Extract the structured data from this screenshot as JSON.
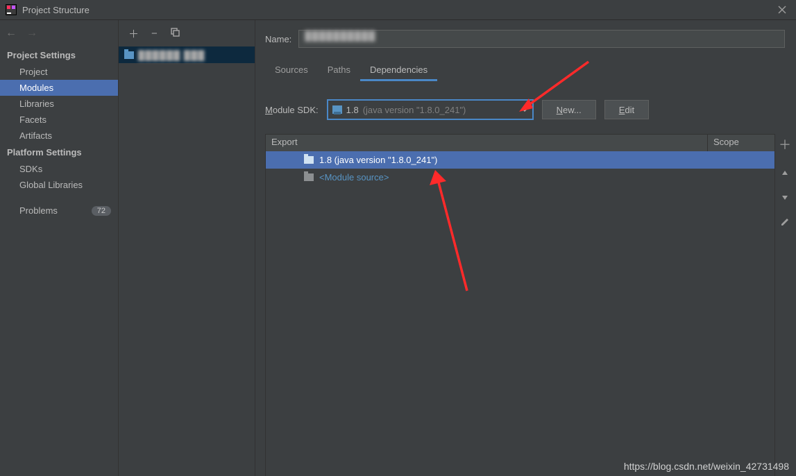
{
  "window": {
    "title": "Project Structure"
  },
  "sidebar": {
    "project_settings_header": "Project Settings",
    "platform_settings_header": "Platform Settings",
    "items": {
      "project": "Project",
      "modules": "Modules",
      "libraries": "Libraries",
      "facets": "Facets",
      "artifacts": "Artifacts",
      "sdks": "SDKs",
      "global_libraries": "Global Libraries",
      "problems": "Problems"
    },
    "problems_count": "72"
  },
  "modules_list": {
    "selected_module_name": "██████ ███"
  },
  "main": {
    "name_label": "Name:",
    "name_value": "██████████",
    "tabs": {
      "sources": "Sources",
      "paths": "Paths",
      "dependencies": "Dependencies"
    },
    "sdk_label_prefix": "M",
    "sdk_label_rest": "odule SDK:",
    "sdk_value_primary": "1.8 ",
    "sdk_value_gray": "(java version \"1.8.0_241\")",
    "new_btn": "New...",
    "edit_btn": "Edit",
    "table": {
      "export_header": "Export",
      "scope_header": "Scope",
      "rows": [
        {
          "label": "1.8 (java version \"1.8.0_241\")",
          "selected": true,
          "link": false
        },
        {
          "label": "<Module source>",
          "selected": false,
          "link": true
        }
      ]
    }
  },
  "watermark": "https://blog.csdn.net/weixin_42731498"
}
